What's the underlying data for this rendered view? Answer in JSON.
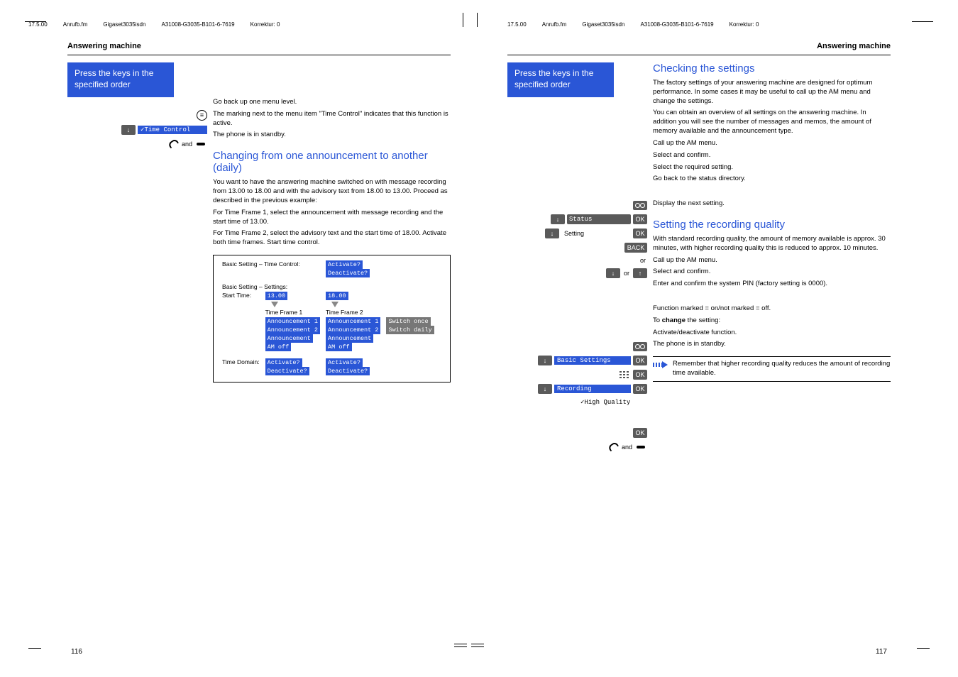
{
  "header": {
    "date": "17.5.00",
    "file": "Anrufb.fm",
    "product": "Gigaset3035isdn",
    "docid": "A31008-G3035-B101-6-7619",
    "korrektur": "Korrektur: 0"
  },
  "left": {
    "section": "Answering machine",
    "press_keys": "Press the keys in the specified order",
    "go_back": "Go back up one menu level.",
    "time_control_item": "✓Time Control",
    "mark_note": "The marking next to the menu item \"Time Control\" indicates that this function is active.",
    "and": "and",
    "standby": "The phone is in standby.",
    "h_changing": "Changing from one announcement to another (daily)",
    "changing_p1": "You want to have the answering machine switched on with message recording from 13.00 to 18.00 and with the advisory text from 18.00 to 13.00. Proceed as described in the previous example:",
    "changing_p2": "For Time Frame 1, select the announcement with message recording and the start time of 13.00.",
    "changing_p3": "For Time Frame 2, select the advisory text and the start time of 18.00. Activate both time frames. Start time control.",
    "diagram": {
      "row1_label": "Basic Setting – Time Control:",
      "activate": "Activate?",
      "deactivate": "Deactivate?",
      "row2_label": "Basic Setting – Settings:",
      "start_time": "Start Time:",
      "t1": "13.00",
      "t2": "18.00",
      "tf1": "Time Frame 1",
      "tf2": "Time Frame 2",
      "ann1": "Announcement 1",
      "ann2": "Announcement 2",
      "ann": "Announcement",
      "amoff": "AM off",
      "switch_once": "Switch once",
      "switch_daily": "Switch daily",
      "time_domain": "Time Domain:"
    },
    "pagenum": "116"
  },
  "right": {
    "section": "Answering machine",
    "press_keys": "Press the keys in the specified order",
    "h_check": "Checking the settings",
    "check_p1": "The factory settings of your answering machine are designed for optimum performance. In some cases it may be useful to call up the AM menu and change the settings.",
    "check_p2": "You can obtain an overview of all settings on the answering machine. In addition you will see the number of messages and memos, the amount of memory available and the announcement type.",
    "call_am": "Call up the AM menu.",
    "status": "Status",
    "select_confirm": "Select and confirm.",
    "setting": "Setting",
    "select_req": "Select the required setting.",
    "back": "BACK",
    "go_back_status": "Go back to the status directory.",
    "or": "or",
    "display_next": "Display the next setting.",
    "h_quality": "Setting the recording quality",
    "quality_p1": "With standard recording quality, the amount of memory available is approx. 30 minutes, with higher recording quality this is reduced to approx. 10 minutes.",
    "basic_settings": "Basic Settings",
    "enter_pin": "Enter and confirm the system PIN (factory setting is 0000).",
    "recording": "Recording",
    "high_quality": "✓High Quality",
    "func_marked": "Function marked = on/not marked = off.",
    "to_change": "To change the setting:",
    "change_word": "change",
    "activate_deact": "Activate/deactivate function.",
    "standby": "The phone is in standby.",
    "and": "and",
    "note": "Remember that higher recording quality reduces the amount of recording time available.",
    "ok": "OK",
    "pagenum": "117"
  }
}
